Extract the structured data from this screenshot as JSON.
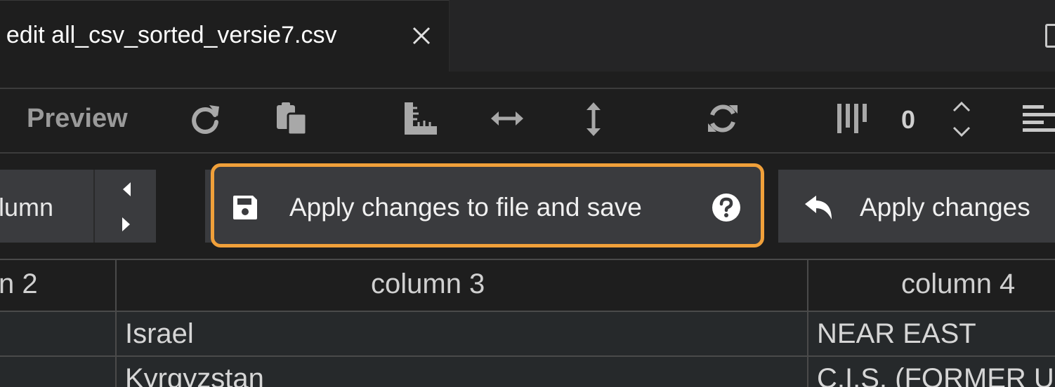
{
  "tab": {
    "title": "/ edit all_csv_sorted_versie7.csv"
  },
  "toolbar": {
    "preview_label": "Preview",
    "number_value": "0",
    "icons": [
      "reload-icon",
      "paste-icon",
      "ruler-icon",
      "resize-horizontal-icon",
      "resize-vertical-icon",
      "sync-icon",
      "columns-icon",
      "stepper-icon",
      "align-left-icon"
    ]
  },
  "buttons": {
    "column_label": "olumn",
    "save_label": "Apply changes to file and save",
    "apply_label": "Apply changes"
  },
  "colors": {
    "highlight": "#f0a03a",
    "button_bg": "#3a3b3e",
    "background": "#1e1e1e"
  },
  "grid": {
    "headers": [
      "n 2",
      "column 3",
      "column 4"
    ],
    "rows": [
      {
        "col3": "Israel",
        "col4": "NEAR EAST"
      },
      {
        "col3": "Kyrgyzstan",
        "col4": "C.I.S. (FORMER US"
      }
    ]
  }
}
